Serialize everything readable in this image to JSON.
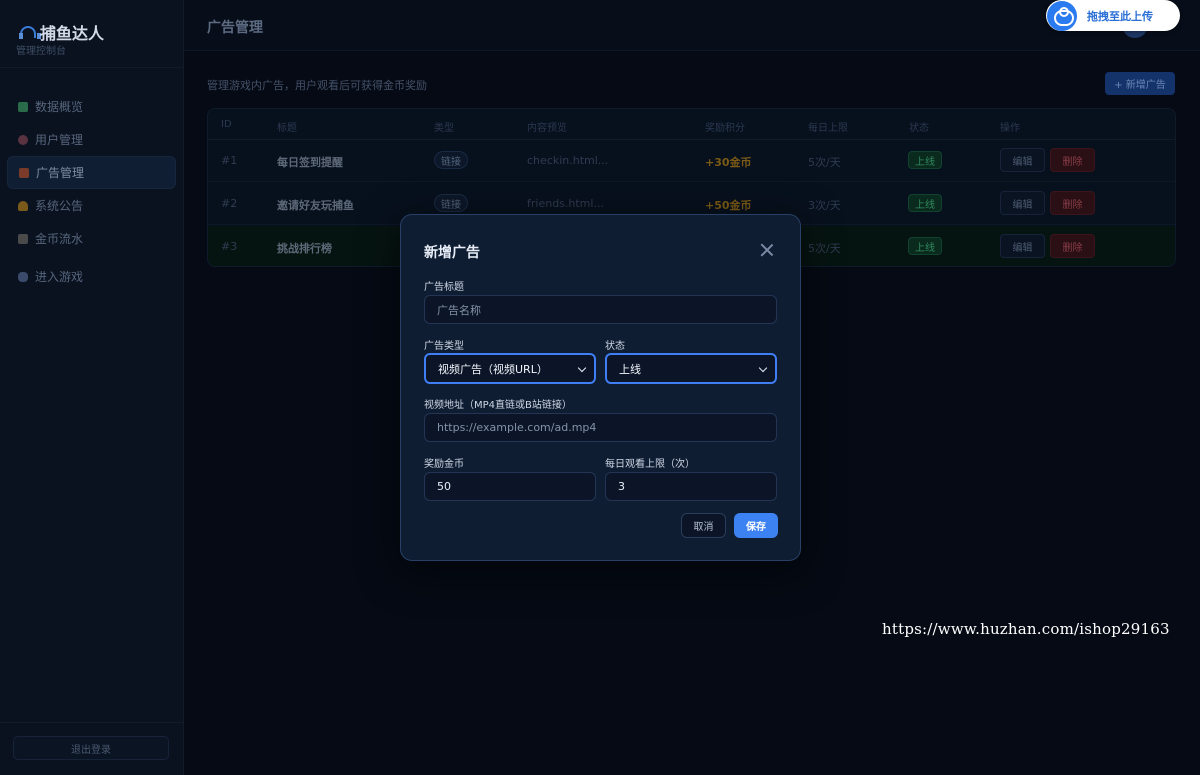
{
  "brand": {
    "title": "捕鱼达人",
    "subtitle": "管理控制台"
  },
  "sidebar": {
    "items": [
      {
        "label": "数据概览",
        "icon": "chart-icon",
        "color": "#2a6b4a"
      },
      {
        "label": "用户管理",
        "icon": "users-icon",
        "color": "#5a3340"
      },
      {
        "label": "广告管理",
        "icon": "megaphone-icon",
        "color": "#7a3b2a",
        "active": true
      },
      {
        "label": "系统公告",
        "icon": "bell-icon",
        "color": "#7a5a1a"
      },
      {
        "label": "金币流水",
        "icon": "ledger-icon",
        "color": "#4a4a4a"
      },
      {
        "label": "进入游戏",
        "icon": "gamepad-icon",
        "color": "#3a4a6a"
      }
    ],
    "logout": "退出登录"
  },
  "header": {
    "title": "广告管理"
  },
  "upload_widget": {
    "label": "拖拽至此上传"
  },
  "main": {
    "description": "管理游戏内广告，用户观看后可获得金币奖励",
    "add_button": "+ 新增广告",
    "table": {
      "columns": [
        "ID",
        "标题",
        "类型",
        "内容预览",
        "奖励积分",
        "每日上限",
        "状态",
        "操作"
      ],
      "rows": [
        {
          "id": "#1",
          "title": "每日签到提醒",
          "type": "链接",
          "preview": "checkin.html...",
          "reward": "+30金币",
          "limit": "5次/天",
          "status": "上线",
          "edit": "编辑",
          "delete": "删除"
        },
        {
          "id": "#2",
          "title": "邀请好友玩捕鱼",
          "type": "链接",
          "preview": "friends.html...",
          "reward": "+50金币",
          "limit": "3次/天",
          "status": "上线",
          "edit": "编辑",
          "delete": "删除"
        },
        {
          "id": "#3",
          "title": "挑战排行榜",
          "type": "",
          "preview": "",
          "reward": "",
          "limit": "5次/天",
          "status": "上线",
          "edit": "编辑",
          "delete": "删除"
        }
      ]
    }
  },
  "modal": {
    "title": "新增广告",
    "ad_title_label": "广告标题",
    "ad_title_placeholder": "广告名称",
    "ad_type_label": "广告类型",
    "ad_type_value": "视频广告（视频URL）",
    "status_label": "状态",
    "status_value": "上线",
    "video_url_label": "视频地址（MP4直链或B站链接）",
    "video_url_placeholder": "https://example.com/ad.mp4",
    "reward_label": "奖励金币",
    "reward_value": "50",
    "daily_limit_label": "每日观看上限（次）",
    "daily_limit_value": "3",
    "cancel": "取消",
    "save": "保存"
  },
  "watermark": "https://www.huzhan.com/ishop29163",
  "colors": {
    "accent": "#3d82f2",
    "background": "#050a14",
    "modal": "#0f1d33"
  }
}
